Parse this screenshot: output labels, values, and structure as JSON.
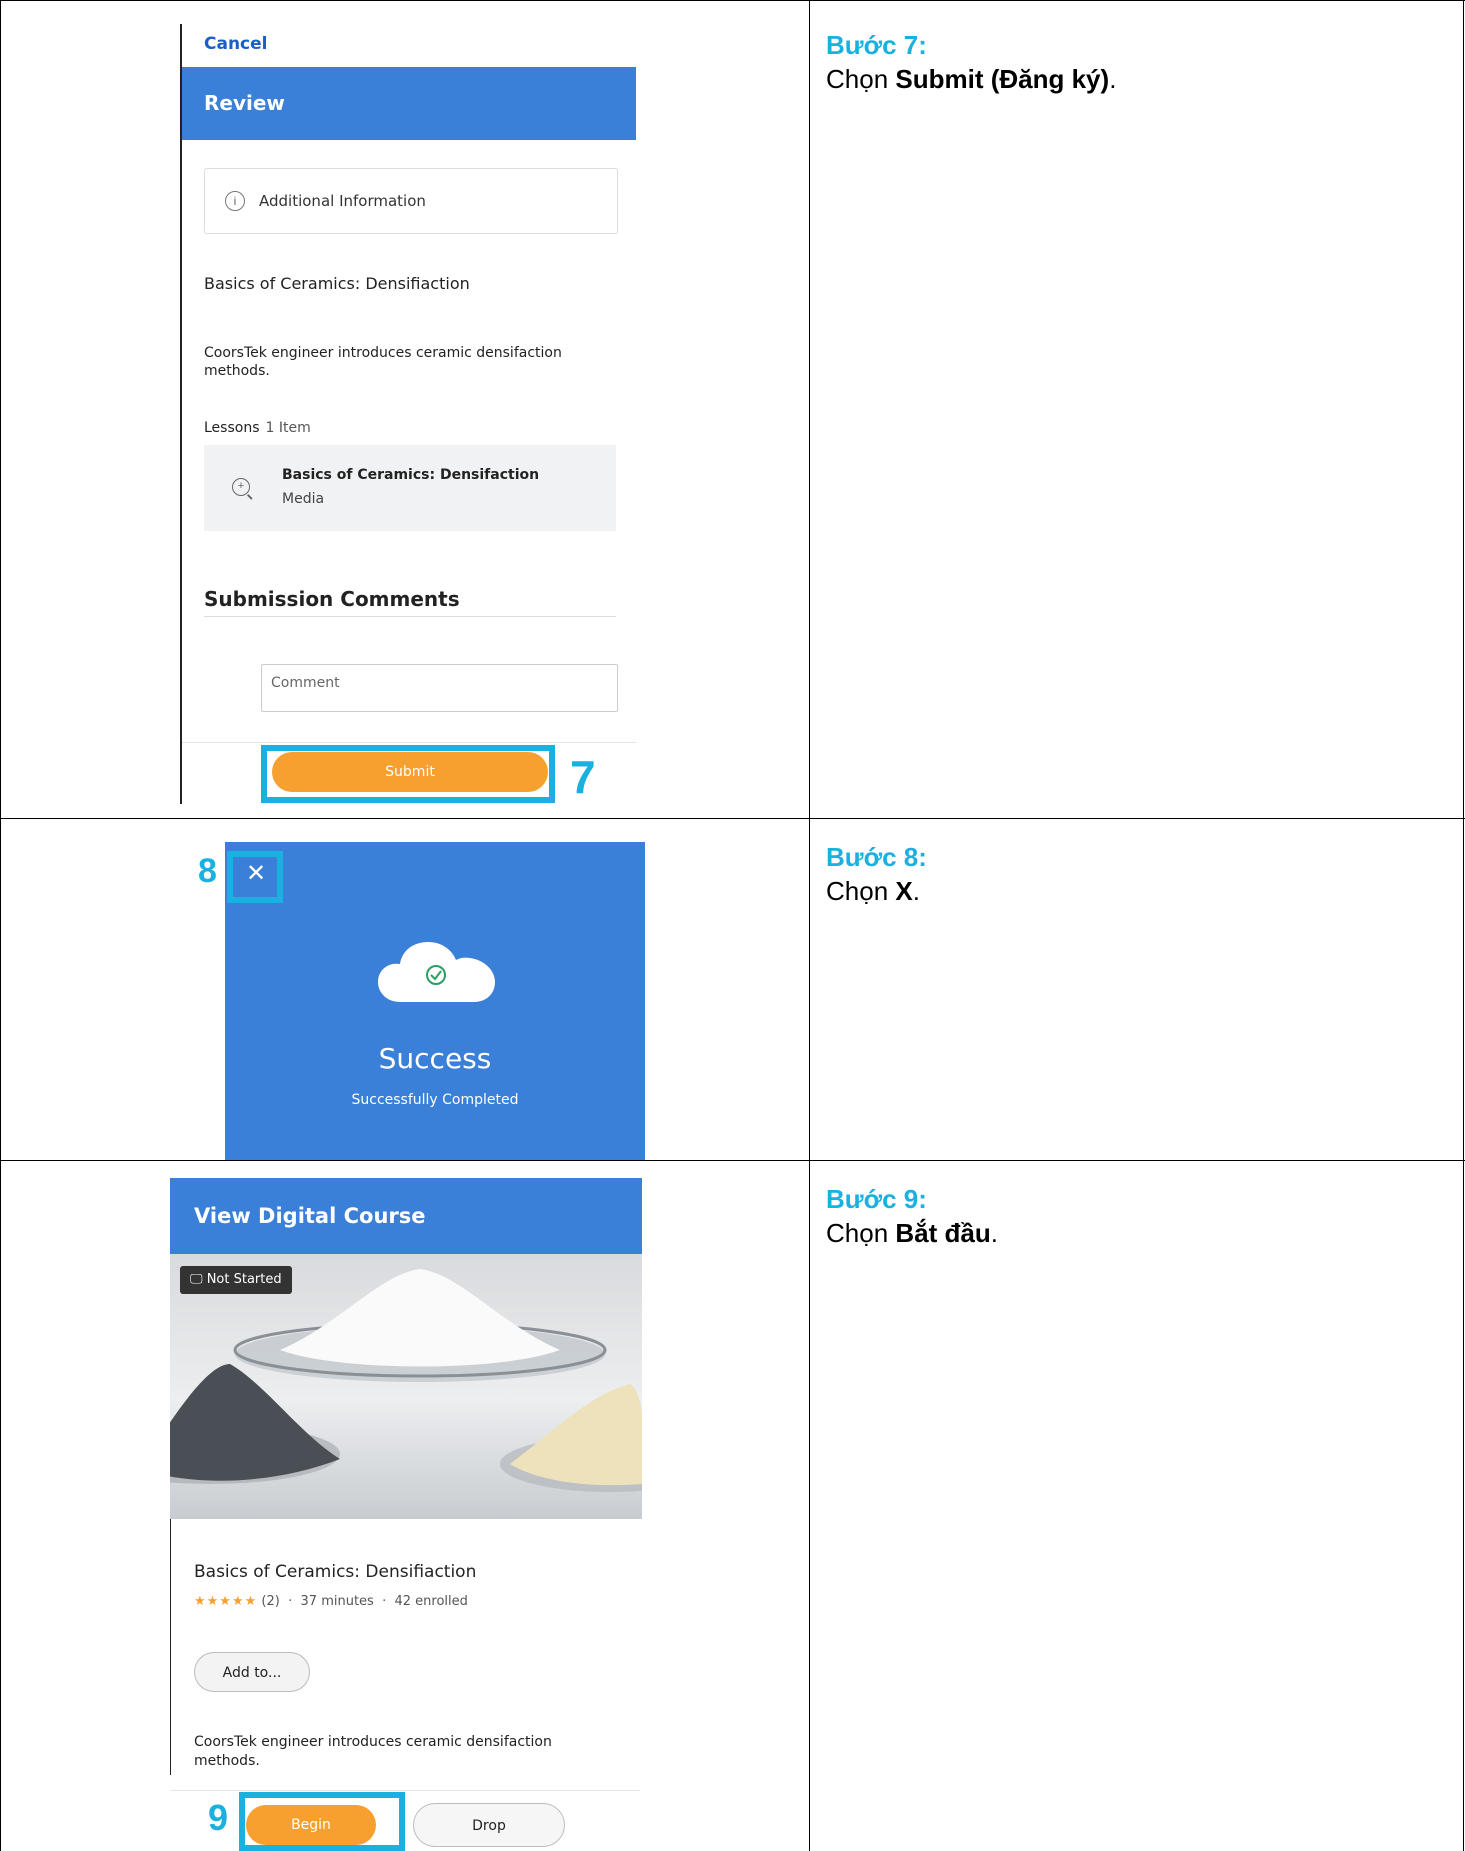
{
  "steps": [
    {
      "title": "Bước 7:",
      "prefix": "Chọn ",
      "bold": "Submit (Đăng ký)",
      "suffix": ".",
      "marker": "7"
    },
    {
      "title": "Bước 8:",
      "prefix": "Chọn ",
      "bold": "X",
      "suffix": ".",
      "marker": "8"
    },
    {
      "title": "Bước 9:",
      "prefix": "Chọn ",
      "bold": "Bắt đầu",
      "suffix": ".",
      "marker": "9"
    }
  ],
  "review": {
    "cancel": "Cancel",
    "header": "Review",
    "info_label": "Additional Information",
    "info_icon": "info-icon",
    "course_title": "Basics of Ceramics: Densifiaction",
    "description": "CoorsTek engineer introduces ceramic densifaction methods.",
    "lessons_label": "Lessons",
    "lessons_count": "1 Item",
    "lesson_name": "Basics of Ceramics: Densifaction",
    "lesson_type": "Media",
    "comments_title": "Submission Comments",
    "comment_placeholder": "Comment",
    "submit_label": "Submit"
  },
  "success": {
    "close_icon": "close-icon",
    "close_glyph": "✕",
    "title": "Success",
    "subtitle": "Successfully Completed"
  },
  "course": {
    "header": "View Digital Course",
    "badge": "Not Started",
    "title": "Basics of Ceramics: Densifiaction",
    "stars": "★★★★★",
    "rating_count": "(2)",
    "duration": "37 minutes",
    "enrolled": "42 enrolled",
    "add_to": "Add to...",
    "description": "CoorsTek engineer introduces ceramic densifaction methods.",
    "begin": "Begin",
    "drop": "Drop"
  },
  "colors": {
    "accent_blue": "#1ab0e0",
    "header_blue": "#3a7fd8",
    "button_orange": "#f7a030"
  }
}
